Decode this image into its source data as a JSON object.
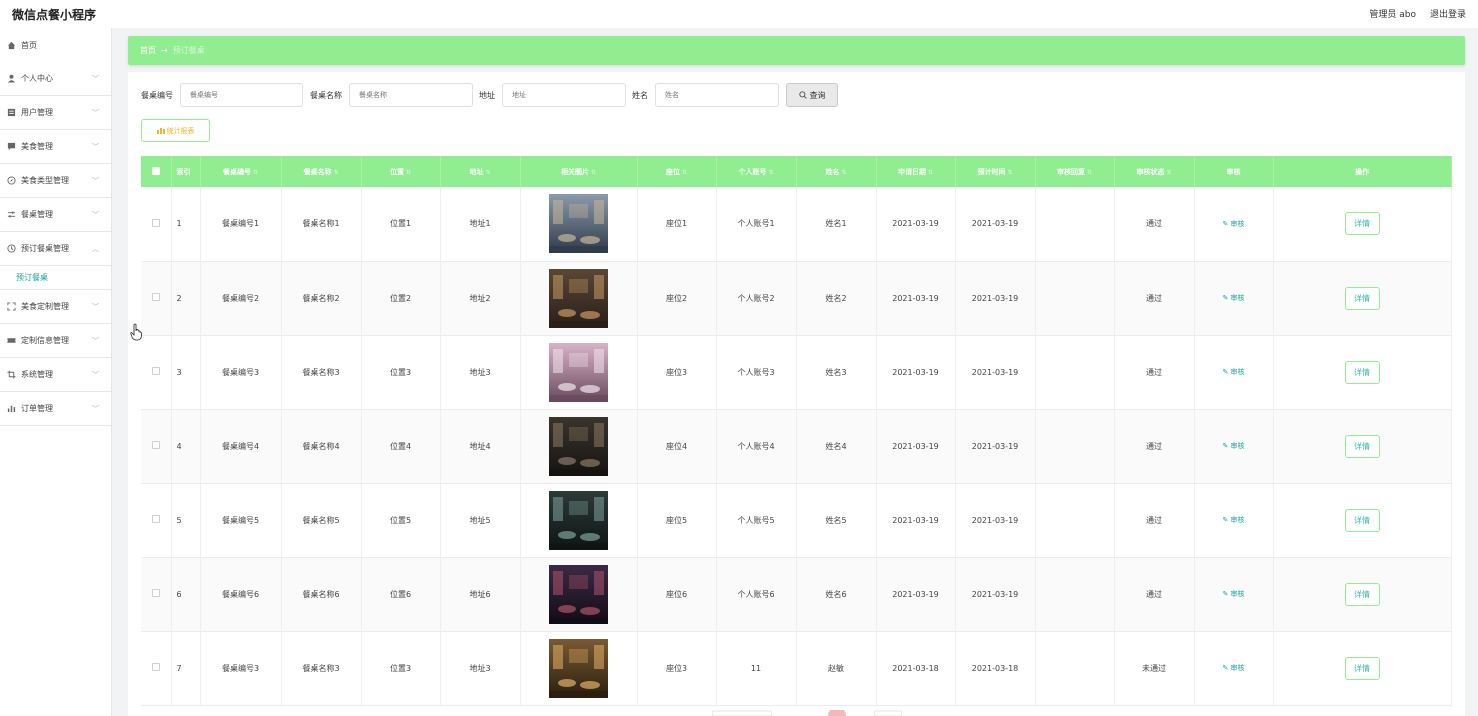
{
  "app": {
    "title": "微信点餐小程序"
  },
  "header": {
    "user_label": "管理员 abo",
    "logout_label": "退出登录"
  },
  "sidebar": {
    "items": [
      {
        "label": "首页",
        "icon": "home-icon"
      },
      {
        "label": "个人中心",
        "icon": "user-icon"
      },
      {
        "label": "用户管理",
        "icon": "list-icon"
      },
      {
        "label": "美食管理",
        "icon": "chat-icon"
      },
      {
        "label": "美食类型管理",
        "icon": "compass-icon"
      },
      {
        "label": "餐桌管理",
        "icon": "sliders-icon"
      },
      {
        "label": "预订餐桌管理",
        "icon": "clock-icon"
      },
      {
        "label": "美食定制管理",
        "icon": "expand-icon"
      },
      {
        "label": "定制信息管理",
        "icon": "ticket-icon"
      },
      {
        "label": "系统管理",
        "icon": "crop-icon"
      },
      {
        "label": "订单管理",
        "icon": "bar-chart-icon"
      }
    ],
    "active_sub": "预订餐桌"
  },
  "breadcrumb": {
    "home": "首页",
    "arrow": "→",
    "current": "预订餐桌"
  },
  "search": {
    "fields": [
      {
        "label": "餐桌编号",
        "placeholder": "餐桌编号"
      },
      {
        "label": "餐桌名称",
        "placeholder": "餐桌名称"
      },
      {
        "label": "地址",
        "placeholder": "地址"
      },
      {
        "label": "姓名",
        "placeholder": "姓名"
      }
    ],
    "query_label": "查询"
  },
  "report_button_label": "统计报表",
  "table": {
    "headers": [
      "索引",
      "餐桌编号",
      "餐桌名称",
      "位置",
      "地址",
      "相关图片",
      "座位",
      "个人账号",
      "姓名",
      "申请日期",
      "预计时间",
      "审核回复",
      "审核状态",
      "审核",
      "操作"
    ],
    "audit_label": "审核",
    "detail_label": "详情",
    "rows": [
      {
        "index": "1",
        "table_no": "餐桌编号1",
        "table_name": "餐桌名称1",
        "position": "位置1",
        "address": "地址1",
        "seat": "座位1",
        "account": "个人账号1",
        "name": "姓名1",
        "apply_date": "2021-03-19",
        "expected_time": "2021-03-19",
        "reply": "",
        "status": "通过",
        "img_colors": [
          "#8a9bab",
          "#2f3b4a",
          "#c9b79a"
        ]
      },
      {
        "index": "2",
        "table_no": "餐桌编号2",
        "table_name": "餐桌名称2",
        "position": "位置2",
        "address": "地址2",
        "seat": "座位2",
        "account": "个人账号2",
        "name": "姓名2",
        "apply_date": "2021-03-19",
        "expected_time": "2021-03-19",
        "reply": "",
        "status": "通过",
        "img_colors": [
          "#5a4636",
          "#2a1f18",
          "#c79a63"
        ]
      },
      {
        "index": "3",
        "table_no": "餐桌编号3",
        "table_name": "餐桌名称3",
        "position": "位置3",
        "address": "地址3",
        "seat": "座位3",
        "account": "个人账号3",
        "name": "姓名3",
        "apply_date": "2021-03-19",
        "expected_time": "2021-03-19",
        "reply": "",
        "status": "通过",
        "img_colors": [
          "#d9b3c7",
          "#6a4a5e",
          "#f0e6ee"
        ]
      },
      {
        "index": "4",
        "table_no": "餐桌编号4",
        "table_name": "餐桌名称4",
        "position": "位置4",
        "address": "地址4",
        "seat": "座位4",
        "account": "个人账号4",
        "name": "姓名4",
        "apply_date": "2021-03-19",
        "expected_time": "2021-03-19",
        "reply": "",
        "status": "通过",
        "img_colors": [
          "#3a342e",
          "#151311",
          "#8c7a62"
        ]
      },
      {
        "index": "5",
        "table_no": "餐桌编号5",
        "table_name": "餐桌名称5",
        "position": "位置5",
        "address": "地址5",
        "seat": "座位5",
        "account": "个人账号5",
        "name": "姓名5",
        "apply_date": "2021-03-19",
        "expected_time": "2021-03-19",
        "reply": "",
        "status": "通过",
        "img_colors": [
          "#2c3a38",
          "#0f1514",
          "#7fa39a"
        ]
      },
      {
        "index": "6",
        "table_no": "餐桌编号6",
        "table_name": "餐桌名称6",
        "position": "位置6",
        "address": "地址6",
        "seat": "座位6",
        "account": "个人账号6",
        "name": "姓名6",
        "apply_date": "2021-03-19",
        "expected_time": "2021-03-19",
        "reply": "",
        "status": "通过",
        "img_colors": [
          "#3b2a45",
          "#120c16",
          "#b0546a"
        ]
      },
      {
        "index": "7",
        "table_no": "餐桌编号3",
        "table_name": "餐桌名称3",
        "position": "位置3",
        "address": "地址3",
        "seat": "座位3",
        "account": "11",
        "name": "赵敏",
        "apply_date": "2021-03-18",
        "expected_time": "2021-03-18",
        "reply": "",
        "status": "未通过",
        "img_colors": [
          "#7a5a32",
          "#2b1e10",
          "#e0b066"
        ]
      }
    ]
  },
  "colors": {
    "accent": "#90ee90",
    "teal": "#1aa39a",
    "report_text": "#f0b429"
  }
}
